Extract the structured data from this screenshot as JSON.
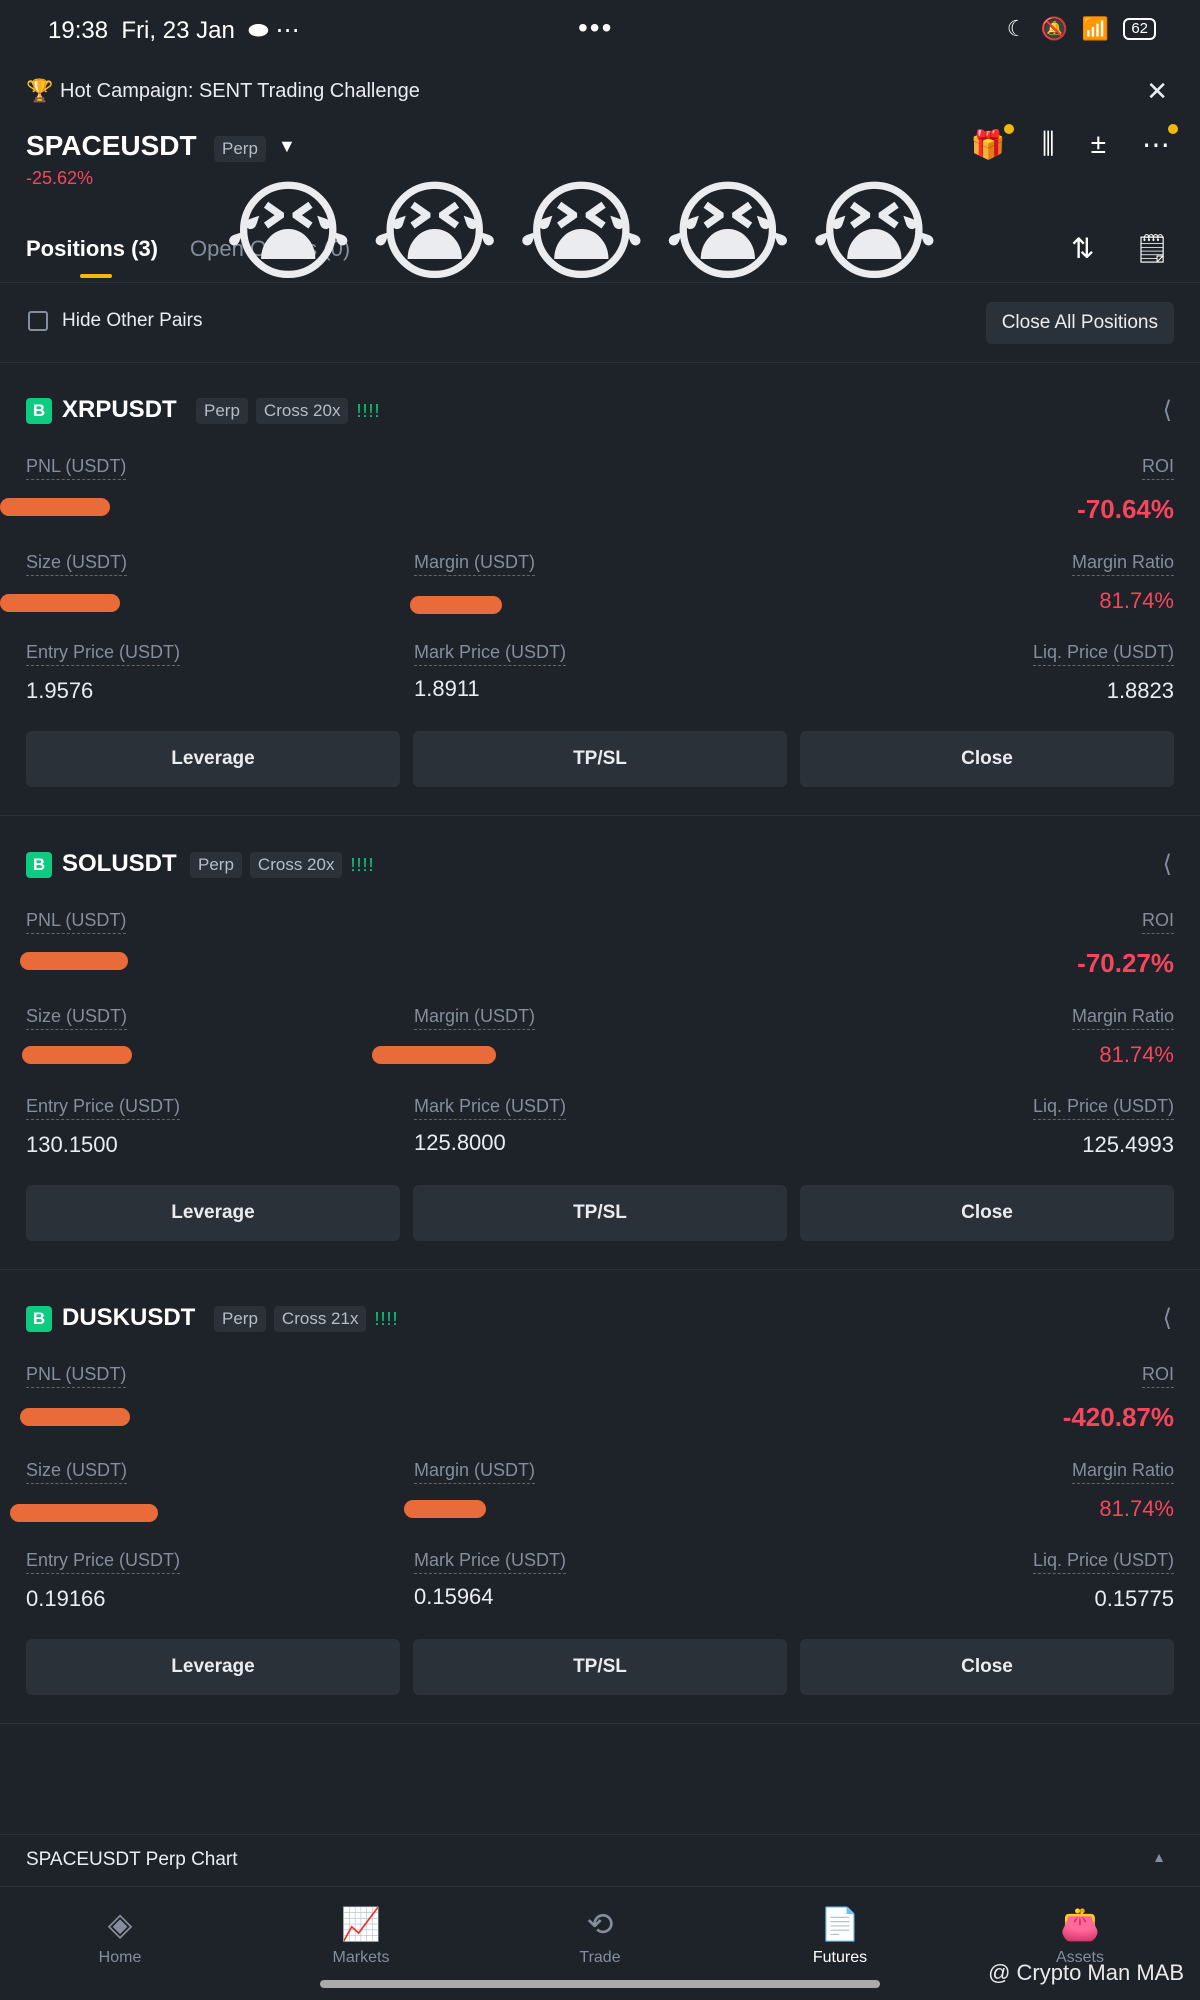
{
  "status_bar": {
    "time": "19:38",
    "date": "Fri, 23 Jan",
    "battery": "62"
  },
  "campaign": {
    "text": "Hot Campaign: SENT Trading Challenge",
    "icon": "trophy-icon"
  },
  "header": {
    "symbol": "SPACEUSDT",
    "type_tag": "Perp",
    "change": "-25.62%"
  },
  "tabs": {
    "positions": "Positions (3)",
    "open_orders": "Open Orders (0)"
  },
  "toolbar": {
    "hide_other_pairs": "Hide Other Pairs",
    "close_all": "Close All Positions"
  },
  "labels": {
    "pnl": "PNL (USDT)",
    "roi": "ROI",
    "size": "Size (USDT)",
    "margin": "Margin (USDT)",
    "margin_ratio": "Margin Ratio",
    "entry_price": "Entry Price (USDT)",
    "mark_price": "Mark Price (USDT)",
    "liq_price": "Liq. Price (USDT)",
    "leverage_btn": "Leverage",
    "tpsl_btn": "TP/SL",
    "close_btn": "Close",
    "side": "B"
  },
  "positions": [
    {
      "pair": "XRPUSDT",
      "type": "Perp",
      "mode": "Cross 20x",
      "roi": "-70.64%",
      "margin_ratio": "81.74%",
      "entry_price": "1.9576",
      "mark_price": "1.8911",
      "liq_price": "1.8823"
    },
    {
      "pair": "SOLUSDT",
      "type": "Perp",
      "mode": "Cross 20x",
      "roi": "-70.27%",
      "margin_ratio": "81.74%",
      "entry_price": "130.1500",
      "mark_price": "125.8000",
      "liq_price": "125.4993"
    },
    {
      "pair": "DUSKUSDT",
      "type": "Perp",
      "mode": "Cross 21x",
      "roi": "-420.87%",
      "margin_ratio": "81.74%",
      "entry_price": "0.19166",
      "mark_price": "0.15964",
      "liq_price": "0.15775"
    }
  ],
  "chart_bar": {
    "text": "SPACEUSDT Perp Chart"
  },
  "nav": {
    "home": "Home",
    "markets": "Markets",
    "trade": "Trade",
    "futures": "Futures",
    "assets": "Assets"
  },
  "watermark": "@ Crypto Man MAB",
  "colors": {
    "background": "#1e2329",
    "loss": "#f6465d",
    "long": "#0ecb81",
    "accent": "#f0b90b"
  }
}
